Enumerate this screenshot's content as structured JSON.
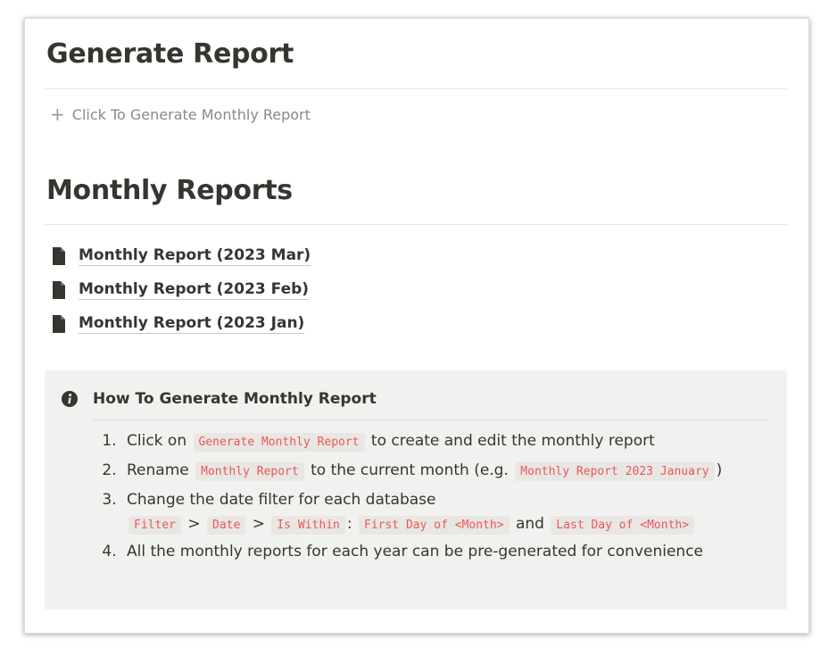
{
  "generate": {
    "title": "Generate Report",
    "button_label": "Click To Generate Monthly Report"
  },
  "monthly": {
    "title": "Monthly Reports",
    "pages": [
      {
        "label": "Monthly Report (2023 Mar)",
        "icon": "document-icon"
      },
      {
        "label": "Monthly Report (2023 Feb)",
        "icon": "document-icon"
      },
      {
        "label": "Monthly Report (2023 Jan)",
        "icon": "document-icon"
      }
    ]
  },
  "callout": {
    "icon": "info-icon",
    "title": "How To Generate Monthly Report",
    "steps": {
      "s1_pre": "Click on",
      "s1_code": "Generate Monthly Report",
      "s1_post": "to create and edit the monthly report",
      "s2_pre": "Rename",
      "s2_code": "Monthly Report",
      "s2_mid": "to the current month (e.g.",
      "s2_code2": "Monthly Report 2023 January",
      "s2_post": ")",
      "s3_text": "Change the date filter for each database",
      "s3_code_filter": "Filter",
      "s3_sep1": ">",
      "s3_code_date": "Date",
      "s3_sep2": ">",
      "s3_code_within": "Is Within",
      "s3_colon": ":",
      "s3_code_first": "First Day of <Month>",
      "s3_and": "and",
      "s3_code_last": "Last Day of <Month>",
      "s4_text": "All the monthly reports for each year can be pre-generated for convenience"
    }
  },
  "colors": {
    "text": "#37352f",
    "muted": "#8a8986",
    "code_text": "#eb5757",
    "code_bg": "#e8e7e4",
    "callout_bg": "#f1f1ef"
  }
}
